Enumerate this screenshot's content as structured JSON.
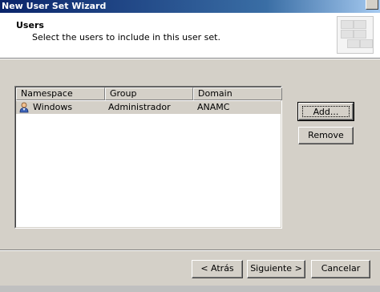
{
  "window": {
    "title": "New User Set Wizard"
  },
  "header": {
    "title": "Users",
    "description": "Select the users to include in this user set."
  },
  "list": {
    "columns": [
      "Namespace",
      "Group",
      "Domain"
    ],
    "rows": [
      {
        "namespace": "Windows",
        "group": "Administrador",
        "domain": "ANAMC",
        "icon": "user-icon"
      }
    ]
  },
  "side_buttons": {
    "add": "Add...",
    "remove": "Remove"
  },
  "footer": {
    "back": "< Atrás",
    "next": "Siguiente >",
    "cancel": "Cancelar"
  },
  "colors": {
    "title_bar": "#0a246a",
    "dialog_bg": "#d4d0c8",
    "selection": "#d4d0c8"
  }
}
